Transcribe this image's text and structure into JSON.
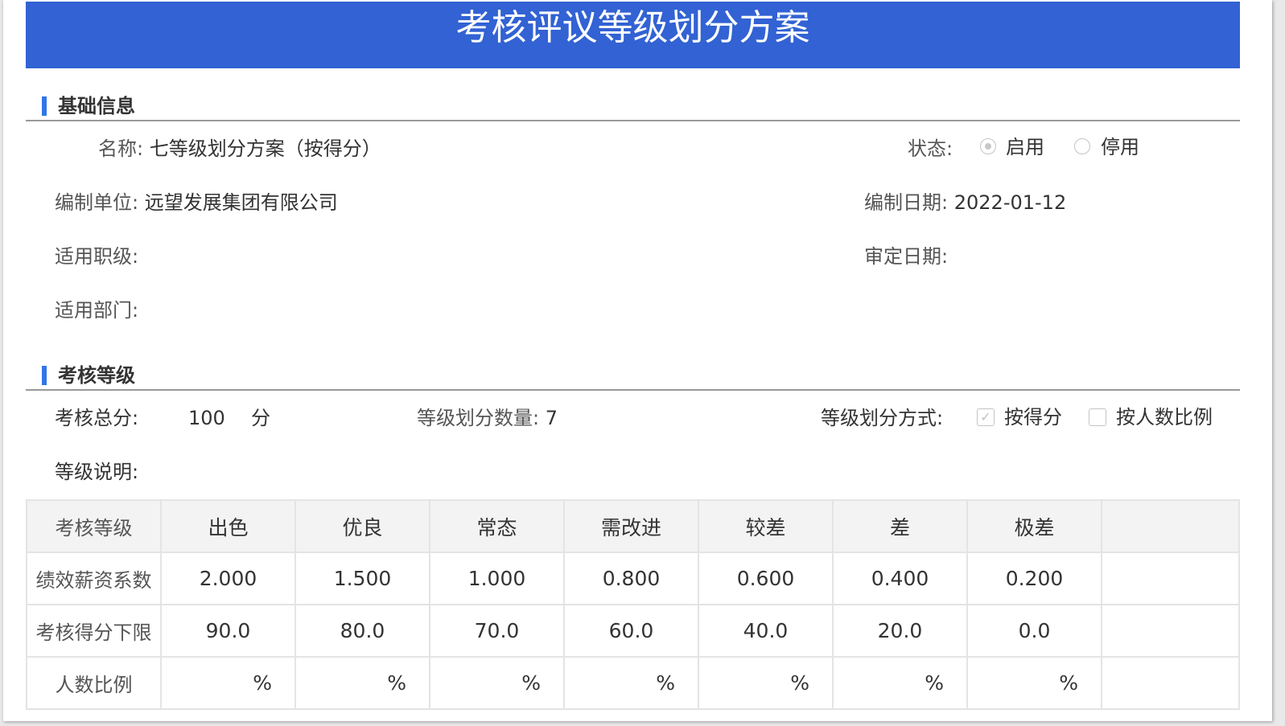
{
  "title": "考核评议等级划分方案",
  "basic": {
    "section_title": "基础信息",
    "name_label": "名称:",
    "name_value": "七等级划分方案（按得分）",
    "status_label": "状态:",
    "status_options": [
      "启用",
      "停用"
    ],
    "status_selected": "启用",
    "unit_label": "编制单位:",
    "unit_value": "远望发展集团有限公司",
    "date_label": "编制日期:",
    "date_value": "2022-01-12",
    "rank_label": "适用职级:",
    "review_date_label": "审定日期:",
    "dept_label": "适用部门:"
  },
  "grade": {
    "section_title": "考核等级",
    "total_label": "考核总分:",
    "total_value": "100",
    "total_unit": "分",
    "count_label": "等级划分数量:",
    "count_value": "7",
    "method_label": "等级划分方式:",
    "method_options": [
      {
        "label": "按得分",
        "checked": true
      },
      {
        "label": "按人数比例",
        "checked": false
      }
    ],
    "desc_label": "等级说明:"
  },
  "table": {
    "header_label": "考核等级",
    "levels": [
      "出色",
      "优良",
      "常态",
      "需改进",
      "较差",
      "差",
      "极差"
    ],
    "coef_label": "绩效薪资系数",
    "coefs": [
      "2.000",
      "1.500",
      "1.000",
      "0.800",
      "0.600",
      "0.400",
      "0.200"
    ],
    "score_label": "考核得分下限",
    "scores": [
      "90.0",
      "80.0",
      "70.0",
      "60.0",
      "40.0",
      "20.0",
      "0.0"
    ],
    "ratio_label": "人数比例",
    "ratio_unit": "%"
  }
}
